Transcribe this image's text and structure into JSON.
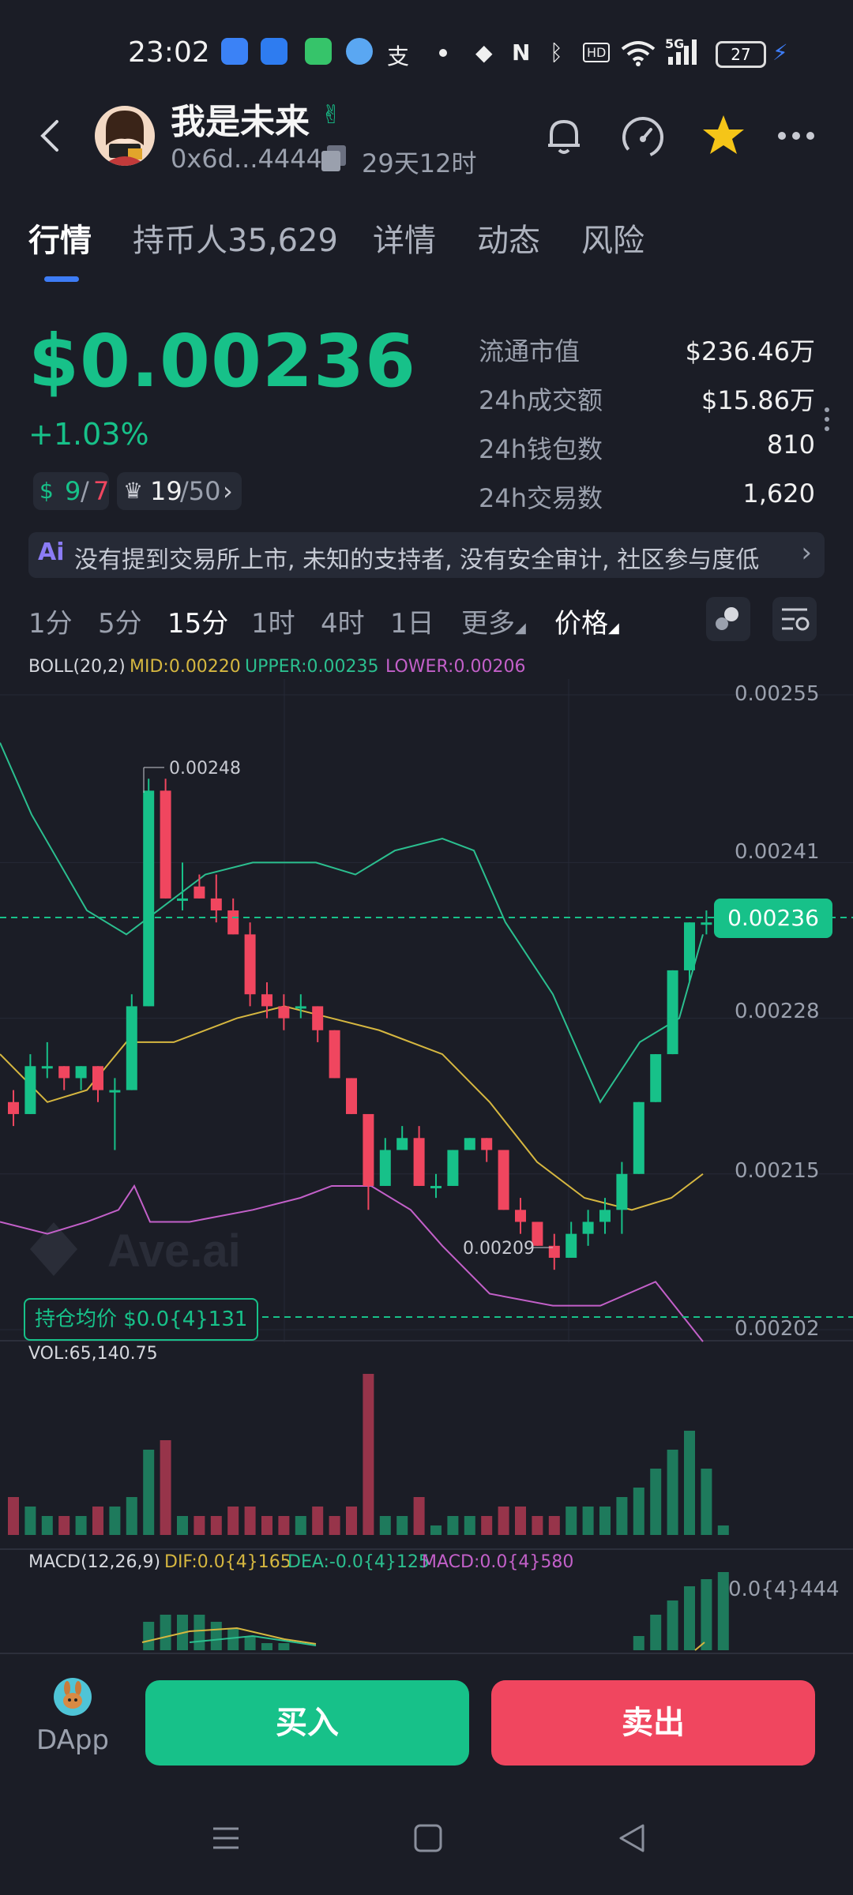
{
  "status_bar": {
    "time": "23:02",
    "net_label": "5G",
    "battery": "27"
  },
  "header": {
    "token_name": "我是未来",
    "address": "0x6d...4444",
    "age": "29天12时"
  },
  "tabs": [
    {
      "label": "行情",
      "active": true
    },
    {
      "label": "持币人35,629"
    },
    {
      "label": "详情"
    },
    {
      "label": "动态"
    },
    {
      "label": "风险"
    }
  ],
  "price": {
    "value": "$0.00236",
    "change": "+1.03%",
    "badge1_a": "9",
    "badge1_sep": "/",
    "badge1_b": "7",
    "badge2_a": "19",
    "badge2_b": "/50"
  },
  "stats": [
    {
      "label": "流通市值",
      "value": "$236.46万"
    },
    {
      "label": "24h成交额",
      "value": "$15.86万"
    },
    {
      "label": "24h钱包数",
      "value": "810"
    },
    {
      "label": "24h交易数",
      "value": "1,620"
    }
  ],
  "ai_banner": {
    "text": "没有提到交易所上市, 未知的支持者, 没有安全审计, 社区参与度低"
  },
  "intervals": {
    "items": [
      "1分",
      "5分",
      "15分",
      "1时",
      "4时",
      "1日"
    ],
    "active": "15分",
    "more": "更多",
    "price_toggle": "价格"
  },
  "chart": {
    "indicator": {
      "name": "BOLL(20,2)",
      "mid": "MID:0.00220",
      "upper": "UPPER:0.00235",
      "lower": "LOWER:0.00206"
    },
    "y_labels": [
      "0.00255",
      "0.00241",
      "0.00228",
      "0.00215",
      "0.00202"
    ],
    "high_label": "0.00248",
    "low_label": "0.00209",
    "current_price": "0.00236",
    "avg_cost": "持仓均价 $0.0{4}131",
    "watermark": "Ave.ai",
    "vol_label": "VOL:65,140.75",
    "macd": {
      "name": "MACD(12,26,9)",
      "dif": "DIF:0.0{4}165",
      "dea": "DEA:-0.0{4}125",
      "macd": "MACD:0.0{4}580",
      "y_label": "0.0{4}444"
    },
    "colors": {
      "up": "#17c189",
      "down": "#f0465f",
      "mid": "#d6b740",
      "upper": "#2bbf8f",
      "lower": "#c360c9"
    }
  },
  "bottom": {
    "dapp": "DApp",
    "buy": "买入",
    "sell": "卖出"
  }
}
